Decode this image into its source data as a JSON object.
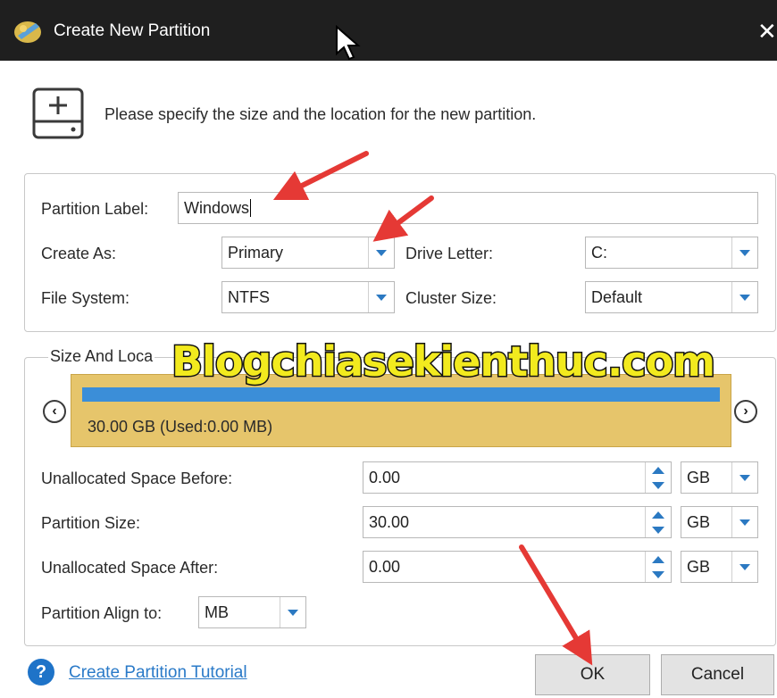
{
  "window": {
    "title": "Create New Partition",
    "close_glyph": "✕"
  },
  "instruction": "Please specify the size and the location for the new partition.",
  "fields": {
    "partition_label": {
      "label": "Partition Label:",
      "value": "Windows"
    },
    "create_as": {
      "label": "Create As:",
      "value": "Primary"
    },
    "drive_letter": {
      "label": "Drive Letter:",
      "value": "C:"
    },
    "file_system": {
      "label": "File System:",
      "value": "NTFS"
    },
    "cluster_size": {
      "label": "Cluster Size:",
      "value": "Default"
    }
  },
  "size_location": {
    "legend": "Size And Loca",
    "partition_bar_text": "30.00 GB (Used:0.00 MB)",
    "nav_left": "‹",
    "nav_right": "›",
    "unallocated_before": {
      "label": "Unallocated Space Before:",
      "value": "0.00",
      "unit": "GB"
    },
    "partition_size": {
      "label": "Partition Size:",
      "value": "30.00",
      "unit": "GB"
    },
    "unallocated_after": {
      "label": "Unallocated Space After:",
      "value": "0.00",
      "unit": "GB"
    },
    "align": {
      "label": "Partition Align to:",
      "value": "MB"
    }
  },
  "watermark": "Blogchiasekienthuc.com",
  "footer": {
    "help_glyph": "?",
    "tutorial_link": "Create Partition Tutorial",
    "ok": "OK",
    "cancel": "Cancel"
  },
  "colors": {
    "accent": "#2b79c2",
    "partition_fill": "#e6c56b",
    "partition_bar": "#3b8ed8",
    "annotation": "#e53935",
    "titlebar": "#1f1f1f"
  }
}
